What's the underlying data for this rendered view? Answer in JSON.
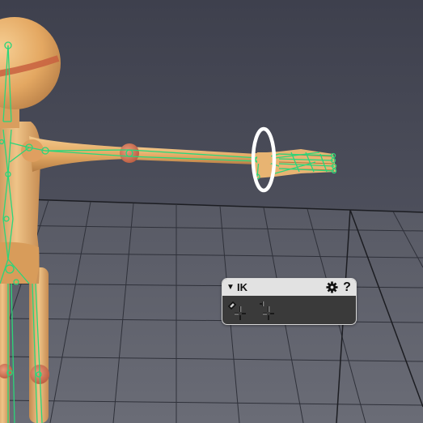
{
  "panel": {
    "title": "IK",
    "collapse_icon": "triangle-down-icon",
    "settings_icon": "gear-icon",
    "help_label": "?",
    "tools": [
      {
        "name": "ik-pin-tool",
        "icon": "pin-crosshair-icon"
      },
      {
        "name": "ik-move-tool",
        "icon": "crosshair-move-icon"
      }
    ]
  },
  "colors": {
    "background": "#4a4c5a",
    "grid_floor": "#595b66",
    "grid_lines": "#2e3038",
    "skin": "#e8b070",
    "joint": "#d07050",
    "bone": "#2ad67a",
    "ik_ring": "#ffffff",
    "panel_header": "#e2e2e2",
    "panel_body": "#3a3a3a"
  }
}
